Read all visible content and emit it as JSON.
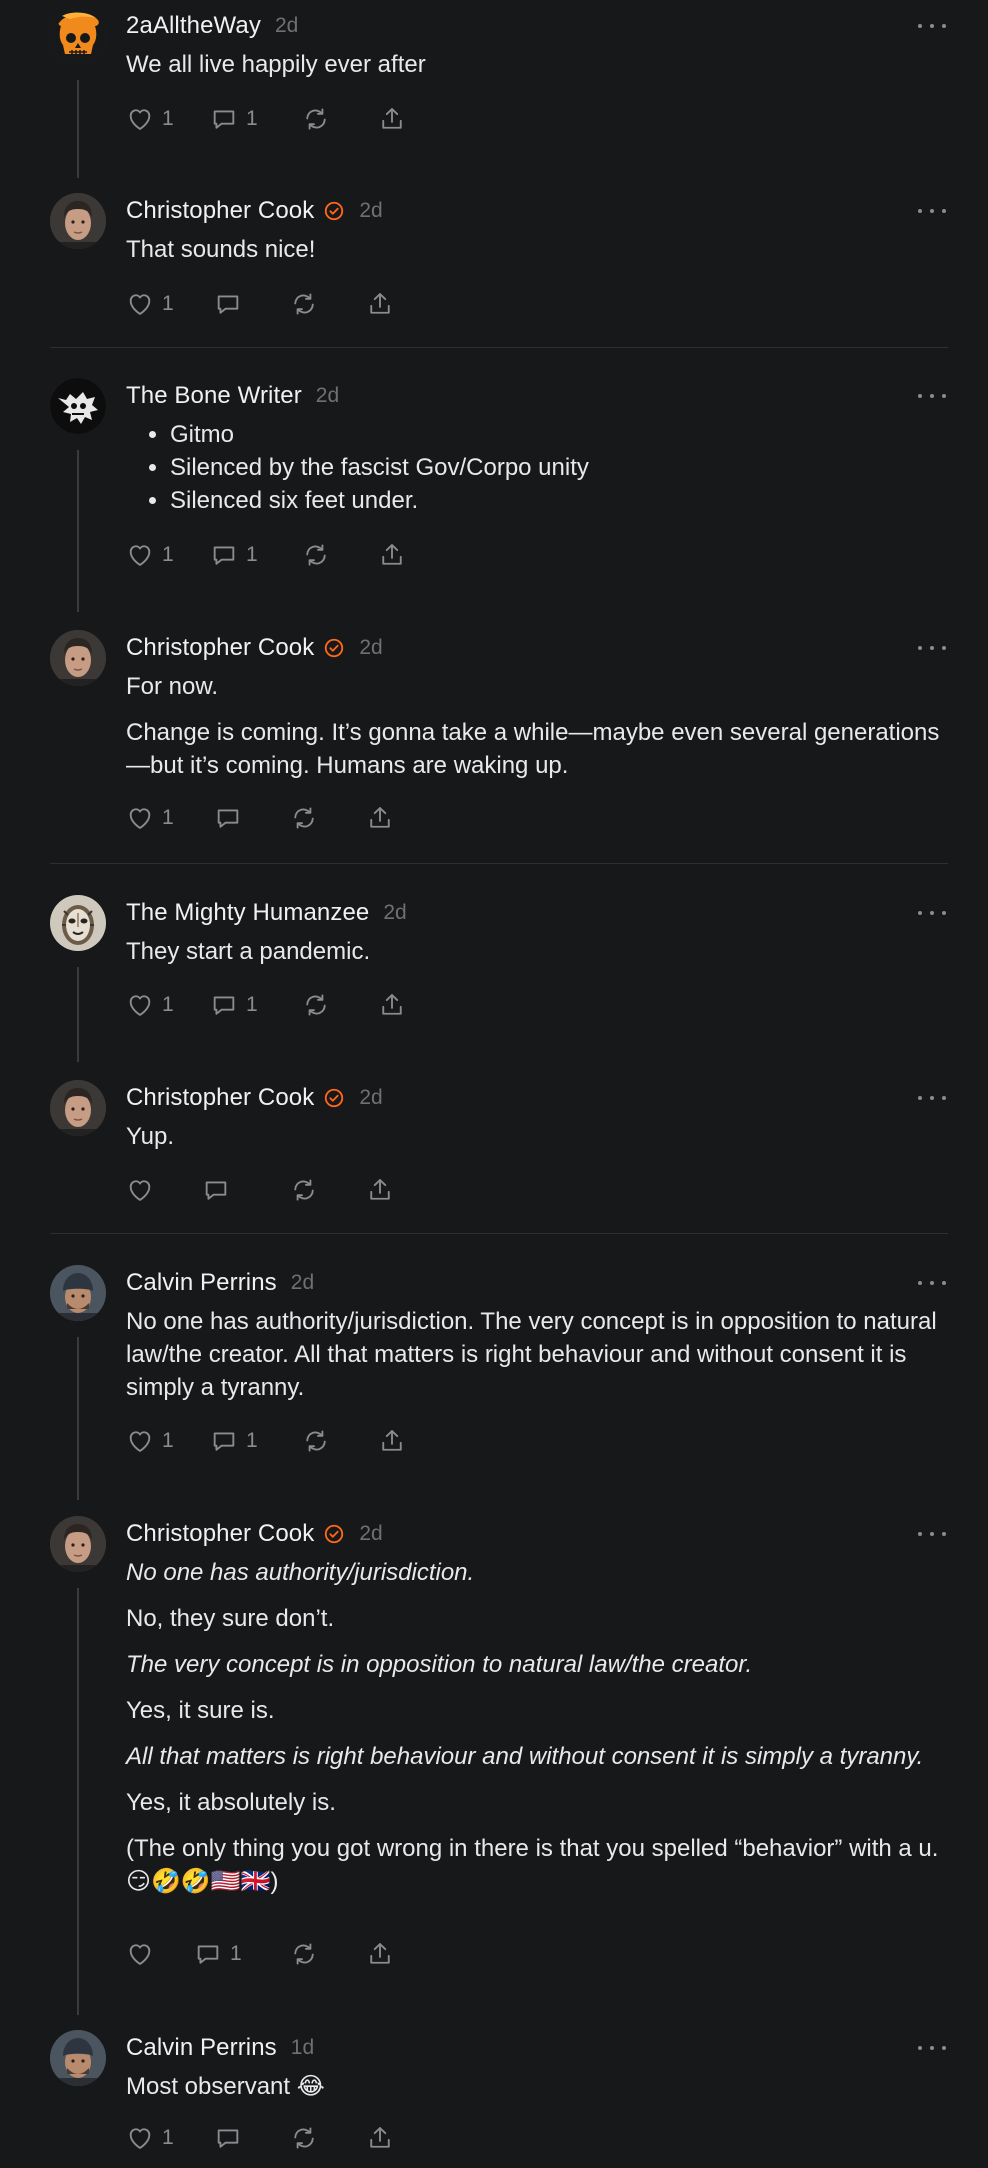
{
  "comments": [
    {
      "author": "2aAlltheWay",
      "verified": false,
      "time": "2d",
      "avatar_icon": "orange-skull-avatar",
      "paragraphs": [
        {
          "text": "We all live happily ever after"
        }
      ],
      "likes": "1",
      "replies": "1"
    },
    {
      "author": "Christopher Cook",
      "verified": true,
      "time": "2d",
      "avatar_icon": "portrait-avatar",
      "paragraphs": [
        {
          "text": "That sounds nice!"
        }
      ],
      "likes": "1",
      "replies": ""
    },
    {
      "author": "The Bone Writer",
      "verified": false,
      "time": "2d",
      "avatar_icon": "white-splatter-avatar",
      "bullets": [
        "Gitmo",
        "Silenced by the fascist Gov/Corpo unity",
        "Silenced six feet under."
      ],
      "likes": "1",
      "replies": "1"
    },
    {
      "author": "Christopher Cook",
      "verified": true,
      "time": "2d",
      "avatar_icon": "portrait-avatar",
      "paragraphs": [
        {
          "text": "For now."
        },
        {
          "text": "Change is coming. It’s gonna take a while—maybe even several generations—but it’s coming. Humans are waking up."
        }
      ],
      "likes": "1",
      "replies": ""
    },
    {
      "author": "The Mighty Humanzee",
      "verified": false,
      "time": "2d",
      "avatar_icon": "tribal-mask-avatar",
      "paragraphs": [
        {
          "text": "They start a pandemic."
        }
      ],
      "likes": "1",
      "replies": "1"
    },
    {
      "author": "Christopher Cook",
      "verified": true,
      "time": "2d",
      "avatar_icon": "portrait-avatar",
      "paragraphs": [
        {
          "text": "Yup."
        }
      ],
      "likes": "",
      "replies": ""
    },
    {
      "author": "Calvin Perrins",
      "verified": false,
      "time": "2d",
      "avatar_icon": "beanie-portrait-avatar",
      "paragraphs": [
        {
          "text": "No one has authority/jurisdiction. The very concept is in opposition to natural law/the creator. All that matters is right behaviour and without consent it is simply a tyranny."
        }
      ],
      "likes": "1",
      "replies": "1"
    },
    {
      "author": "Christopher Cook",
      "verified": true,
      "time": "2d",
      "avatar_icon": "portrait-avatar",
      "paragraphs": [
        {
          "text": "No one has authority/jurisdiction.",
          "italic": true
        },
        {
          "text": "No, they sure don’t."
        },
        {
          "text": "The very concept is in opposition to natural law/the creator.",
          "italic": true
        },
        {
          "text": "Yes, it sure is."
        },
        {
          "text": "All that matters is right behaviour and without consent it is simply a tyranny.",
          "italic": true
        },
        {
          "text": "Yes, it absolutely is."
        },
        {
          "text": "(The only thing you got wrong in there is that you spelled “behavior” with a u. 😏🤣🤣🇺🇸🇬🇧)"
        }
      ],
      "likes": "",
      "replies": "1"
    },
    {
      "author": "Calvin Perrins",
      "verified": false,
      "time": "1d",
      "avatar_icon": "beanie-portrait-avatar",
      "paragraphs": [
        {
          "text": "Most observant 😂"
        }
      ],
      "likes": "1",
      "replies": ""
    }
  ],
  "colors": {
    "background": "#17181a",
    "verified_badge": "#ff6719",
    "muted": "#8b8c90",
    "thread_line": "#3a3b3e"
  },
  "icons": {
    "like": "heart-icon",
    "reply": "comment-bubble-icon",
    "restack": "restack-icon",
    "share": "share-icon",
    "verified": "verified-check-icon",
    "more": "more-dots-icon"
  }
}
